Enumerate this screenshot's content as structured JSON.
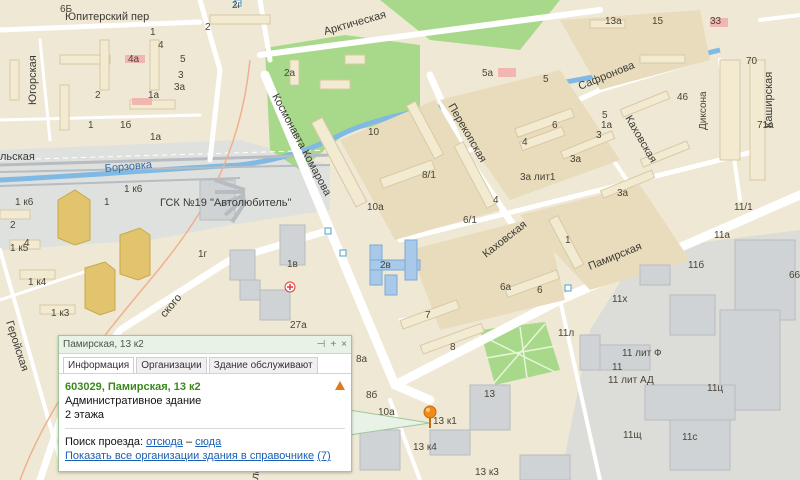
{
  "streets": {
    "yupiterskiy": "Юпитерский пер",
    "yugorskaya": "Югорская",
    "arkticheskaya": "Арктическая",
    "safronova": "Сафронова",
    "kosmonavta_komarova": "Космонавта Комарова",
    "perekopskaya": "Перекопская",
    "kakhovskaya_1": "Каховская",
    "kakhovskaya_2": "Каховская",
    "pamirskaya": "Памирская",
    "kashirskaya": "Каширская",
    "dikson": "Диксона",
    "borzovka": "Борзовка",
    "geroyskaya": "Геройская",
    "ckogo": "ского",
    "lskaya": "льская",
    "lenskogo": "ленского"
  },
  "poi": {
    "gsk": "ГСК №19 \"Автолюбитель\""
  },
  "house_numbers": [
    "6Б",
    "2г",
    "1",
    "2",
    "4",
    "5",
    "13а",
    "15",
    "33",
    "2а",
    "4а",
    "3",
    "3а",
    "5а",
    "1а",
    "2",
    "1",
    "1б",
    "1а",
    "10",
    "4",
    "6",
    "3",
    "1а",
    "8/1",
    "3а лит1",
    "5",
    "10а",
    "6/1",
    "4",
    "3а",
    "3а",
    "2в",
    "6а",
    "6",
    "1",
    "5",
    "70",
    "71а",
    "46",
    "11/1",
    "11а",
    "11б",
    "66",
    "1в",
    "27а",
    "7",
    "8",
    "8а",
    "8б",
    "10а",
    "11л",
    "11",
    "11х",
    "11 лит Ф",
    "11 лит АД",
    "11ц",
    "13",
    "13 к1",
    "13 к4",
    "13 к3",
    "11щ",
    "11с",
    "1г",
    "1",
    "1 к6",
    "1 к5",
    "1 к4",
    "1 к3",
    "1 к6",
    "4",
    "2",
    "6"
  ],
  "popup": {
    "title": "Памирская, 13 к2",
    "controls": {
      "pin": "⊣",
      "plus": "+",
      "close": "×"
    },
    "tabs": [
      "Информация",
      "Организации",
      "Здание обслуживают"
    ],
    "address": "603029, Памирская, 13 к2",
    "type": "Административное здание",
    "floors": "2 этажа",
    "route_label": "Поиск проезда:",
    "route_from": "отсюда",
    "route_dash": "–",
    "route_to": "сюда",
    "show_all": "Показать все организации здания в справочнике",
    "show_all_count": "(7)"
  },
  "colors": {
    "background": "#efe8d4",
    "block": "#e8dcbc",
    "building": "#f3ead2",
    "park": "#a8d98a",
    "water": "#7fb9e4",
    "road": "#ffffff",
    "railway": "#b6bcc2",
    "industrial": "#cfd3d6",
    "marker": "#f28a1a"
  },
  "icons": [
    "map-marker-icon",
    "warning-icon",
    "pin-icon",
    "expand-icon",
    "close-icon",
    "bus-stop-icon",
    "medical-icon"
  ]
}
